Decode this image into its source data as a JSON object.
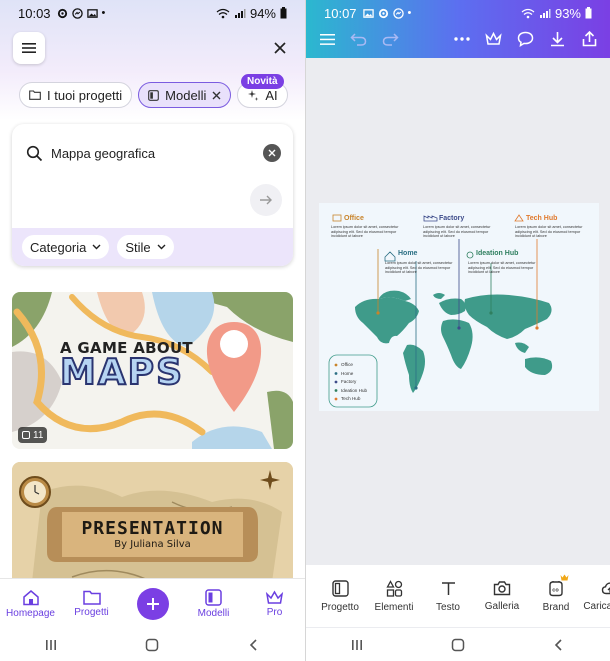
{
  "left_screen": {
    "status": {
      "time": "10:03",
      "battery": "94%"
    },
    "chips": [
      {
        "label": "I tuoi progetti",
        "icon": "folder-icon"
      },
      {
        "label": "Modelli",
        "icon": "template-icon"
      },
      {
        "label": "AI",
        "icon": "sparkle-icon"
      }
    ],
    "new_badge": "Novità",
    "search": {
      "value": "Mappa geografica"
    },
    "filters": [
      "Categoria",
      "Stile"
    ],
    "template1": {
      "line1": "A GAME ABOUT",
      "line2": "MAPS",
      "page_count": "11"
    },
    "template2": {
      "title": "PRESENTATION",
      "author": "By Juliana Silva"
    },
    "bottom_nav": [
      {
        "label": "Homepage",
        "icon": "home-icon"
      },
      {
        "label": "Progetti",
        "icon": "folder-icon"
      },
      {
        "label": "",
        "icon": "plus-icon"
      },
      {
        "label": "Modelli",
        "icon": "template-icon"
      },
      {
        "label": "Pro",
        "icon": "crown-icon"
      }
    ]
  },
  "right_screen": {
    "status": {
      "time": "10:07",
      "battery": "93%"
    },
    "design": {
      "labels": {
        "office": "Office",
        "factory": "Factory",
        "tech_hub": "Tech Hub",
        "home": "Home",
        "ideation_hub": "Ideation Hub"
      },
      "body_text": "Lorem ipsum dolor sit amet, consectetur adipiscing elit. Sed do eiusmod tempor incididunt ut labore",
      "legend": [
        "Office",
        "Home",
        "Factory",
        "Ideation Hub",
        "Tech Hub"
      ],
      "legend_colors": [
        "#c8842b",
        "#2b6f84",
        "#3d4b8a",
        "#2f7f5f",
        "#e07a2e"
      ],
      "map_color": "#3f9b8a"
    },
    "bottom_tools": [
      {
        "label": "Progetto",
        "icon": "layout-icon"
      },
      {
        "label": "Elementi",
        "icon": "shapes-icon"
      },
      {
        "label": "Testo",
        "icon": "text-icon"
      },
      {
        "label": "Galleria",
        "icon": "camera-icon"
      },
      {
        "label": "Brand",
        "icon": "brand-icon"
      },
      {
        "label": "Caricamenti",
        "icon": "upload-cloud-icon"
      }
    ]
  }
}
